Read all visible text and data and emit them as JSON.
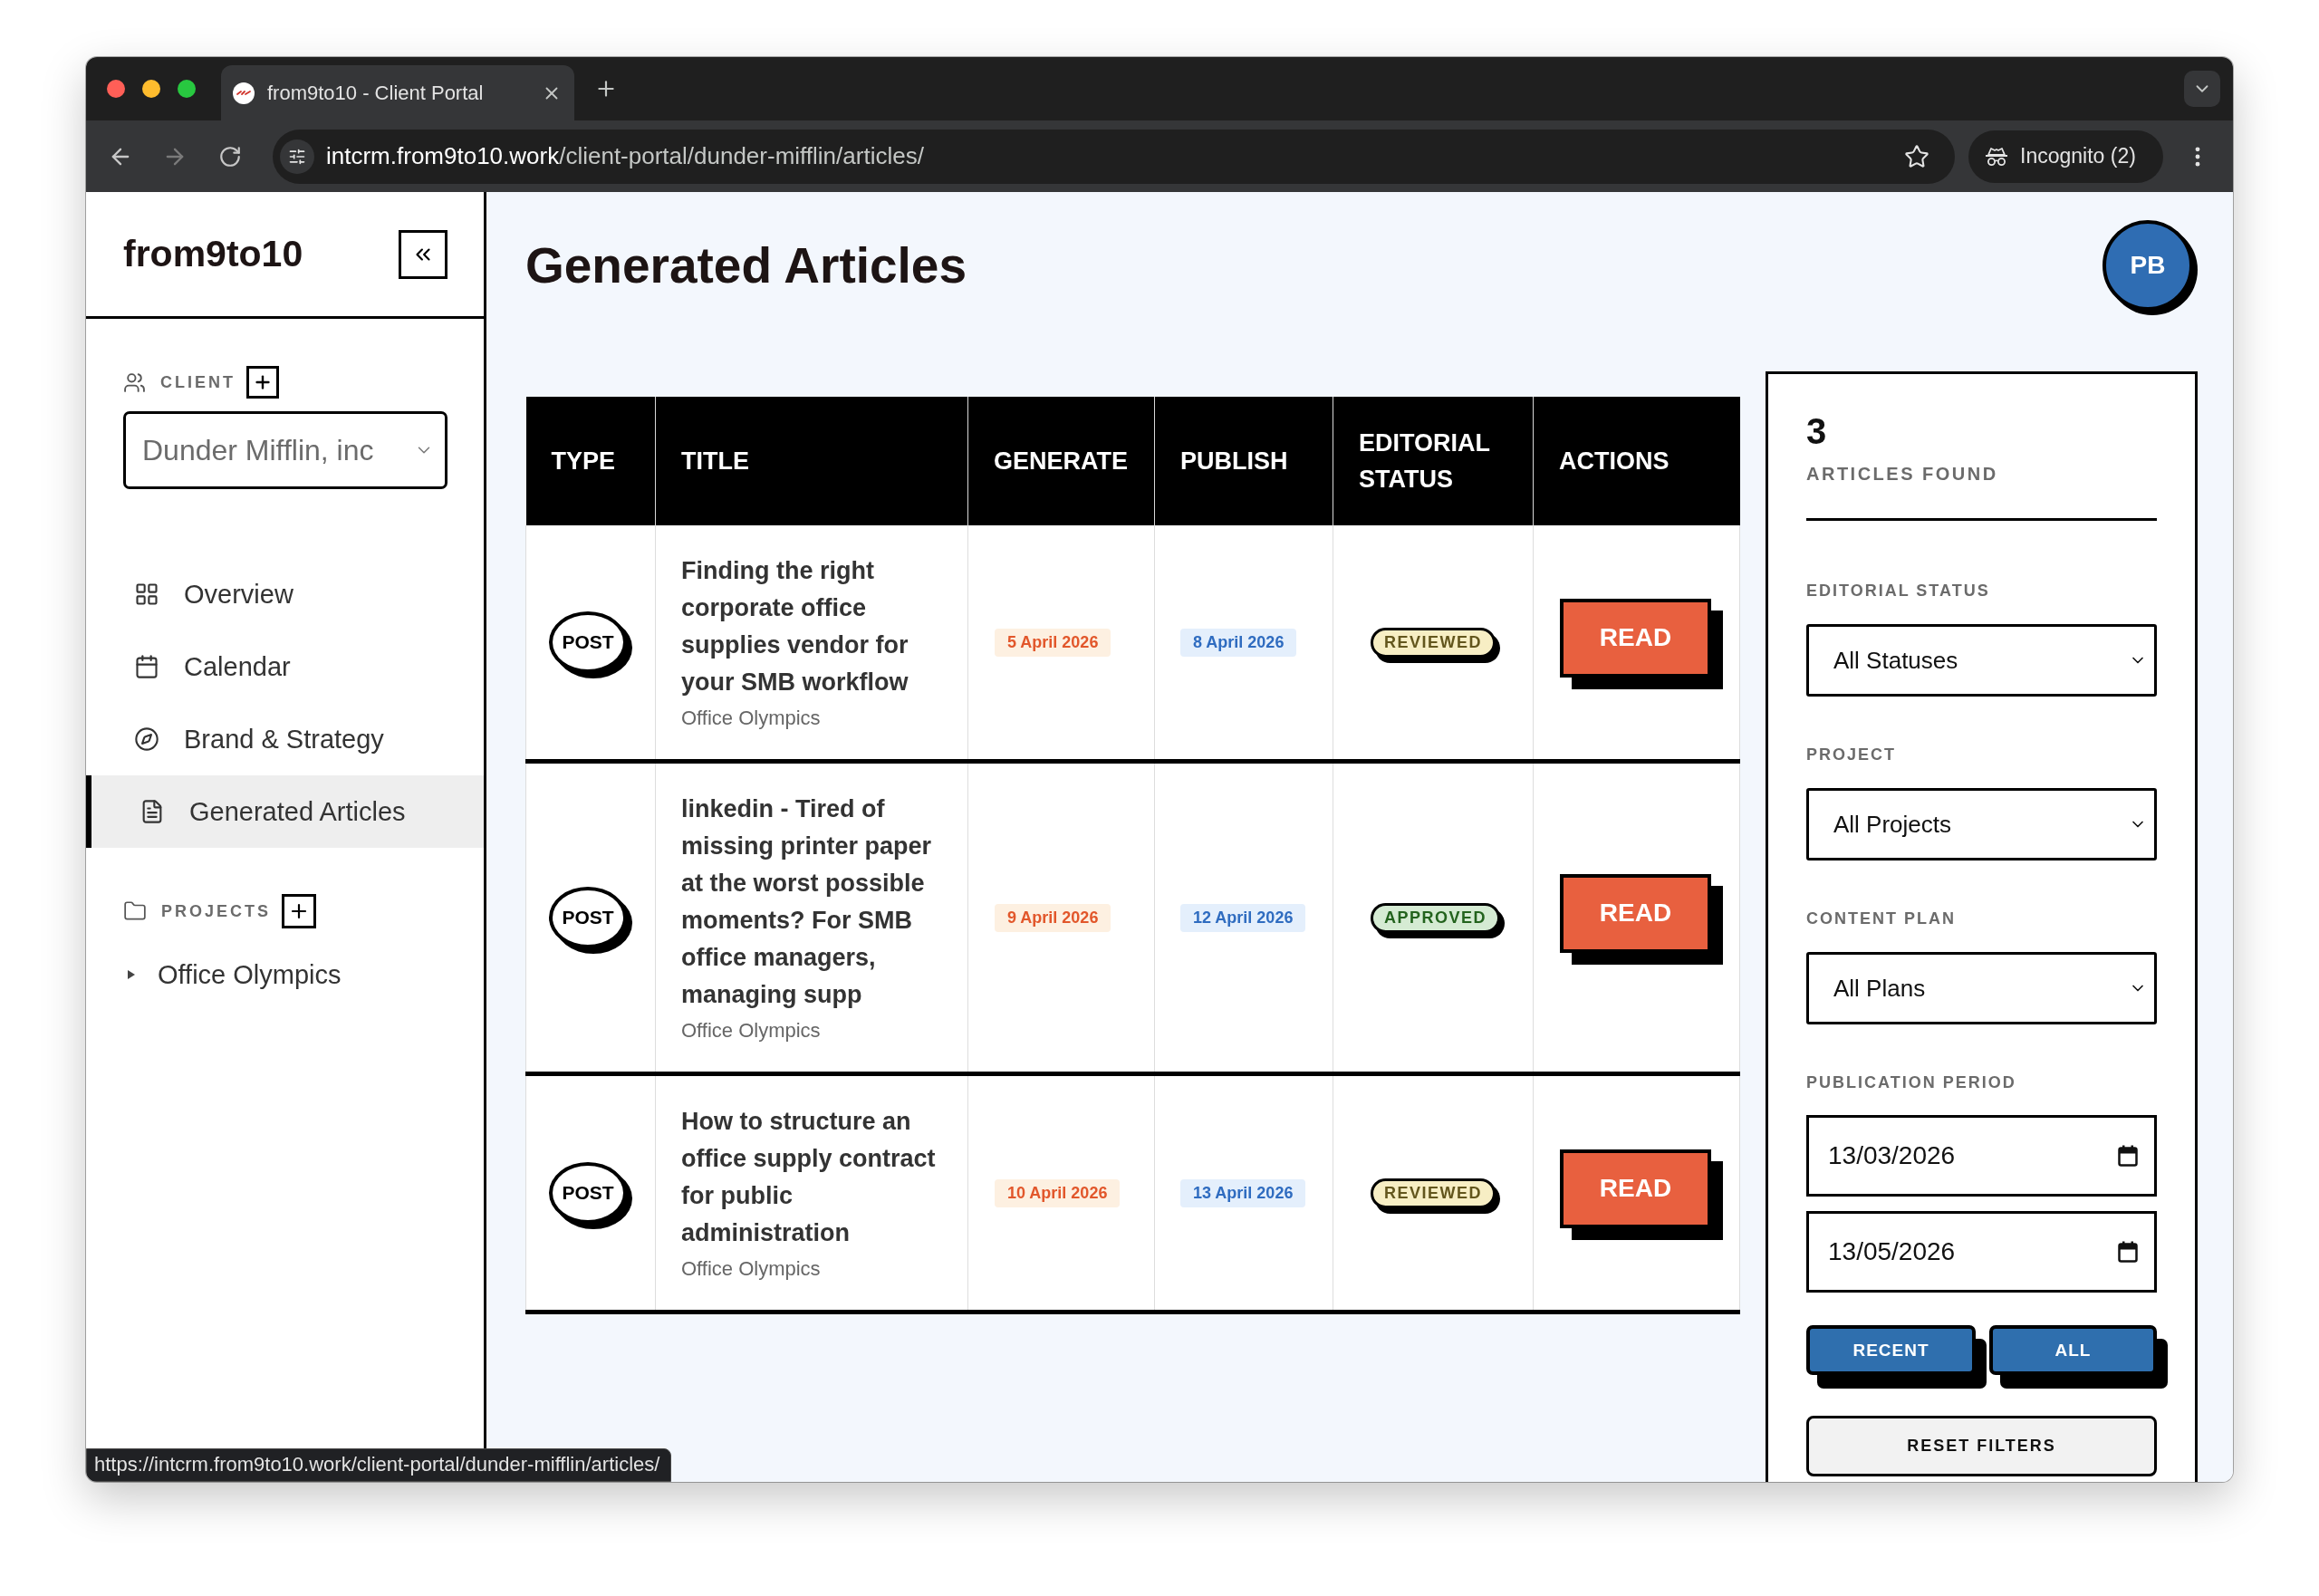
{
  "browser": {
    "tab_title": "from9to10 - Client Portal",
    "url_host": "intcrm.from9to10.work",
    "url_path": "/client-portal/dunder-mifflin/articles/",
    "profile": "Incognito (2)"
  },
  "sidebar": {
    "logo": "from9to10",
    "client_label": "CLIENT",
    "client_value": "Dunder Mifflin, inc",
    "nav": [
      {
        "label": "Overview",
        "selected": false
      },
      {
        "label": "Calendar",
        "selected": false
      },
      {
        "label": "Brand & Strategy",
        "selected": false
      },
      {
        "label": "Generated Articles",
        "selected": true
      }
    ],
    "projects_label": "PROJECTS",
    "projects": [
      {
        "label": "Office Olympics",
        "expanded": false
      }
    ]
  },
  "page": {
    "title": "Generated Articles",
    "avatar": "PB"
  },
  "table": {
    "columns": [
      "TYPE",
      "TITLE",
      "GENERATE",
      "PUBLISH",
      "EDITORIAL STATUS",
      "ACTIONS"
    ],
    "rows": [
      {
        "type": "POST",
        "title": "Finding the right corporate office supplies vendor for your SMB workflow",
        "project": "Office Olympics",
        "generate": "5 April 2026",
        "publish": "8 April 2026",
        "status": {
          "label": "REVIEWED",
          "color": "#f7eec4"
        },
        "action": "READ"
      },
      {
        "type": "POST",
        "title": "linkedin - Tired of missing printer paper at the worst possible moments? For SMB office managers, managing supp",
        "project": "Office Olympics",
        "generate": "9 April 2026",
        "publish": "12 April 2026",
        "status": {
          "label": "APPROVED",
          "color": "#d5ebd3"
        },
        "action": "READ"
      },
      {
        "type": "POST",
        "title": "How to structure an office supply contract for public administration",
        "project": "Office Olympics",
        "generate": "10 April 2026",
        "publish": "13 April 2026",
        "status": {
          "label": "REVIEWED",
          "color": "#f7eec4"
        },
        "action": "READ"
      }
    ]
  },
  "filters": {
    "count": "3",
    "count_label": "ARTICLES FOUND",
    "selects": [
      {
        "label": "EDITORIAL STATUS",
        "value": "All Statuses"
      },
      {
        "label": "PROJECT",
        "value": "All Projects"
      },
      {
        "label": "CONTENT PLAN",
        "value": "All Plans"
      }
    ],
    "period_label": "PUBLICATION PERIOD",
    "dates": [
      "13/03/2026",
      "13/05/2026"
    ],
    "quick_buttons": [
      "RECENT",
      "ALL"
    ],
    "reset": "RESET FILTERS"
  },
  "status_bubble": "https://intcrm.from9to10.work/client-portal/dunder-mifflin/articles/"
}
